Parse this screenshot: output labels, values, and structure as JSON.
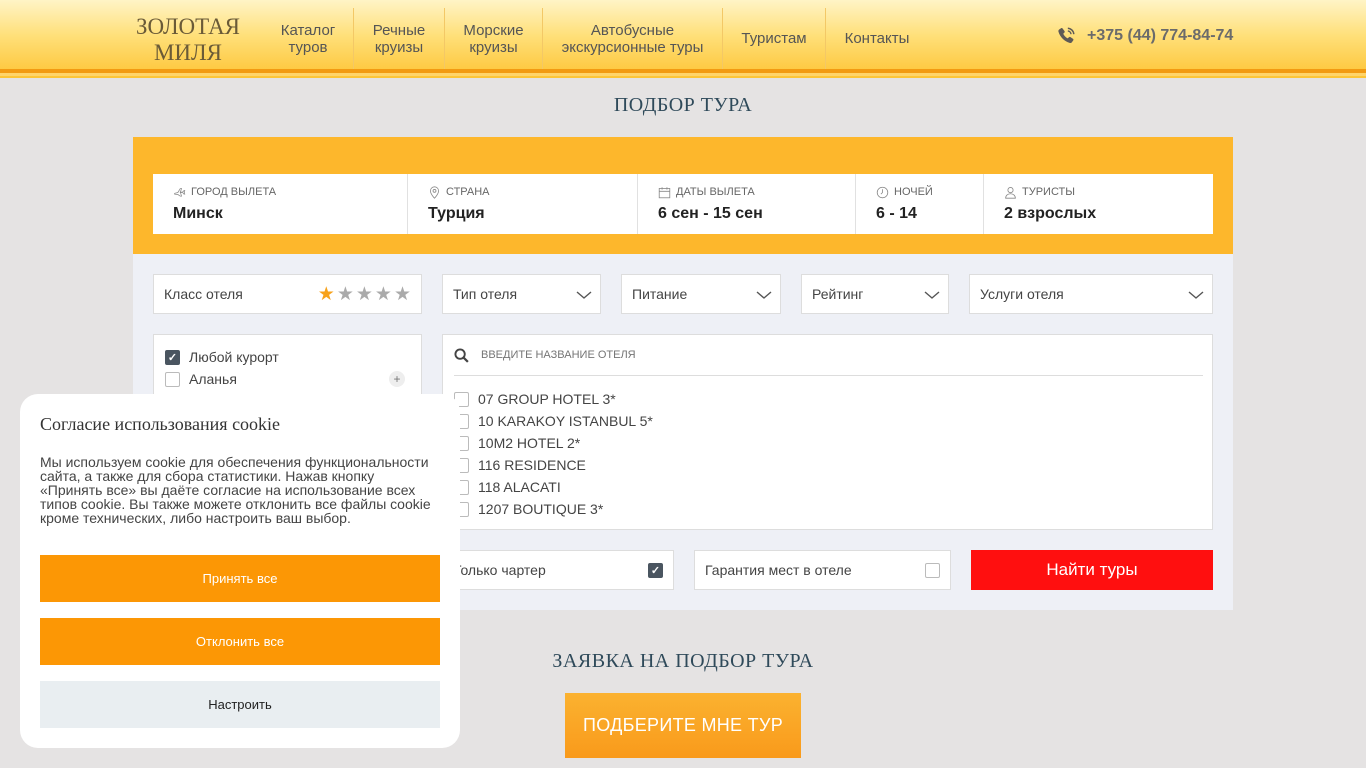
{
  "header": {
    "logo_line1": "ЗОЛОТАЯ",
    "logo_line2": "МИЛЯ",
    "nav": [
      {
        "line1": "Каталог",
        "line2": "туров"
      },
      {
        "line1": "Речные",
        "line2": "круизы"
      },
      {
        "line1": "Морские",
        "line2": "круизы"
      },
      {
        "line1": "Автобусные",
        "line2": "экскурсионные туры"
      },
      {
        "line1": "Туристам",
        "line2": ""
      },
      {
        "line1": "Контакты",
        "line2": ""
      }
    ],
    "phone": "+375 (44) 774-84-74"
  },
  "page_title": "ПОДБОР ТУРА",
  "search": {
    "fields": [
      {
        "label": "ГОРОД ВЫЛЕТА",
        "value": "Минск",
        "icon": "plane-icon"
      },
      {
        "label": "СТРАНА",
        "value": "Турция",
        "icon": "location-pin-icon"
      },
      {
        "label": "ДАТЫ ВЫЛЕТА",
        "value": "6 сен - 15 сен",
        "icon": "calendar-icon"
      },
      {
        "label": "НОЧЕЙ",
        "value": "6 - 14",
        "icon": "clock-icon"
      },
      {
        "label": "ТУРИСТЫ",
        "value": "2 взрослых",
        "icon": "person-icon"
      }
    ],
    "filters": {
      "hotel_class": "Класс отеля",
      "hotel_class_stars_selected": 1,
      "hotel_type": "Тип отеля",
      "meals": "Питание",
      "rating": "Рейтинг",
      "services": "Услуги отеля"
    },
    "resorts": [
      {
        "label": "Любой курорт",
        "checked": true
      },
      {
        "label": "Аланья",
        "checked": false
      }
    ],
    "hotel_search_placeholder": "введите название отеля",
    "hotels": [
      "07 GROUP HOTEL 3*",
      "10 KARAKOY ISTANBUL 5*",
      "10M2 HOTEL 2*",
      "116 RESIDENCE",
      "118 ALACATI",
      "1207 BOUTIQUE 3*"
    ],
    "charter_only": "Только чартер",
    "charter_checked": true,
    "guarantee": "Гарантия мест в отеле",
    "guarantee_checked": false,
    "find_button": "Найти туры"
  },
  "request": {
    "title": "ЗАЯВКА НА ПОДБОР ТУРА",
    "button": "ПОДБЕРИТЕ МНЕ ТУР"
  },
  "cookie": {
    "title": "Согласие использования cookie",
    "text": "Мы используем cookie для обеспечения функциональности сайта, а также для сбора статистики. Нажав кнопку «Принять все» вы даёте согласие на использование всех типов cookie. Вы также можете отклонить все файлы cookie кроме технических, либо настроить ваш выбор.",
    "accept": "Принять все",
    "reject": "Отклонить все",
    "configure": "Настроить"
  },
  "colors": {
    "accent_orange": "#fc9705",
    "form_yellow": "#fdb72c",
    "find_red": "#ff0f0f",
    "title_blue": "#2f4a5a"
  }
}
